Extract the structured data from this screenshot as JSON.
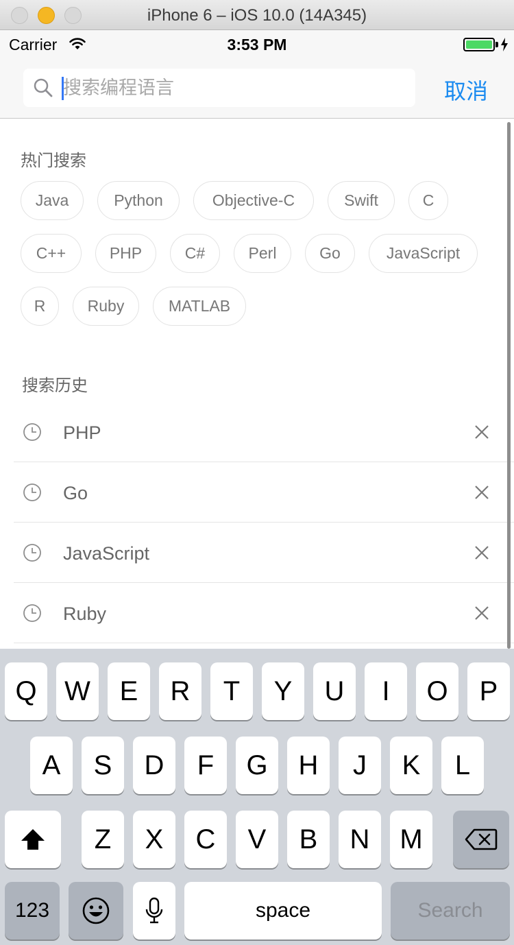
{
  "window": {
    "title": "iPhone 6 – iOS 10.0 (14A345)"
  },
  "status_bar": {
    "carrier": "Carrier",
    "time": "3:53 PM"
  },
  "search": {
    "placeholder": "搜索编程语言",
    "value": "",
    "cancel_label": "取消"
  },
  "hot": {
    "title": "热门搜索",
    "tags": [
      "Java",
      "Python",
      "Objective-C",
      "Swift",
      "C",
      "C++",
      "PHP",
      "C#",
      "Perl",
      "Go",
      "JavaScript",
      "R",
      "Ruby",
      "MATLAB"
    ]
  },
  "history": {
    "title": "搜索历史",
    "items": [
      "PHP",
      "Go",
      "JavaScript",
      "Ruby"
    ]
  },
  "keyboard": {
    "row1": [
      "Q",
      "W",
      "E",
      "R",
      "T",
      "Y",
      "U",
      "I",
      "O",
      "P"
    ],
    "row2": [
      "A",
      "S",
      "D",
      "F",
      "G",
      "H",
      "J",
      "K",
      "L"
    ],
    "row3": [
      "Z",
      "X",
      "C",
      "V",
      "B",
      "N",
      "M"
    ],
    "numbers_label": "123",
    "space_label": "space",
    "search_label": "Search"
  },
  "colors": {
    "accent": "#1b8bf0",
    "battery": "#4cd964",
    "keyboard_bg": "#d1d5db"
  }
}
